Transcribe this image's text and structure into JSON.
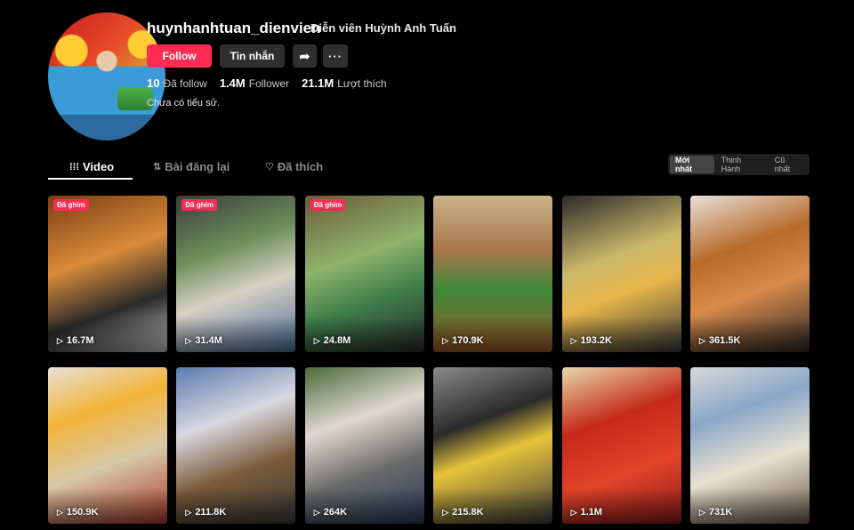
{
  "profile": {
    "username": "huynhanhtuan_dienvien",
    "nickname": "Diễn viên Huỳnh Anh Tuấn",
    "follow_label": "Follow",
    "message_label": "Tin nhắn",
    "share_icon": "share-icon",
    "more_icon": "more-icon",
    "stats": [
      {
        "value": "10",
        "label": "Đã follow"
      },
      {
        "value": "1.4M",
        "label": "Follower"
      },
      {
        "value": "21.1M",
        "label": "Lượt thích"
      }
    ],
    "bio": "Chưa có tiểu sử."
  },
  "tabs": [
    {
      "label": "Video",
      "icon": "grid-icon",
      "active": true
    },
    {
      "label": "Bài đăng lại",
      "icon": "repost-icon",
      "active": false
    },
    {
      "label": "Đã thích",
      "icon": "heart-icon",
      "active": false
    }
  ],
  "sort": [
    {
      "label": "Mới nhất",
      "active": true
    },
    {
      "label": "Thịnh Hành",
      "active": false
    },
    {
      "label": "Cũ nhất",
      "active": false
    }
  ],
  "pinned_label": "Đã ghim",
  "videos": [
    {
      "views": "16.7M",
      "pinned": true
    },
    {
      "views": "31.4M",
      "pinned": true
    },
    {
      "views": "24.8M",
      "pinned": true
    },
    {
      "views": "170.9K",
      "pinned": false
    },
    {
      "views": "193.2K",
      "pinned": false
    },
    {
      "views": "361.5K",
      "pinned": false
    },
    {
      "views": "150.9K",
      "pinned": false
    },
    {
      "views": "211.8K",
      "pinned": false
    },
    {
      "views": "264K",
      "pinned": false
    },
    {
      "views": "215.8K",
      "pinned": false
    },
    {
      "views": "1.1M",
      "pinned": false
    },
    {
      "views": "731K",
      "pinned": false
    }
  ],
  "colors": {
    "accent": "#fe2c55",
    "background": "#000000",
    "button_dark": "#2f2f2f"
  }
}
